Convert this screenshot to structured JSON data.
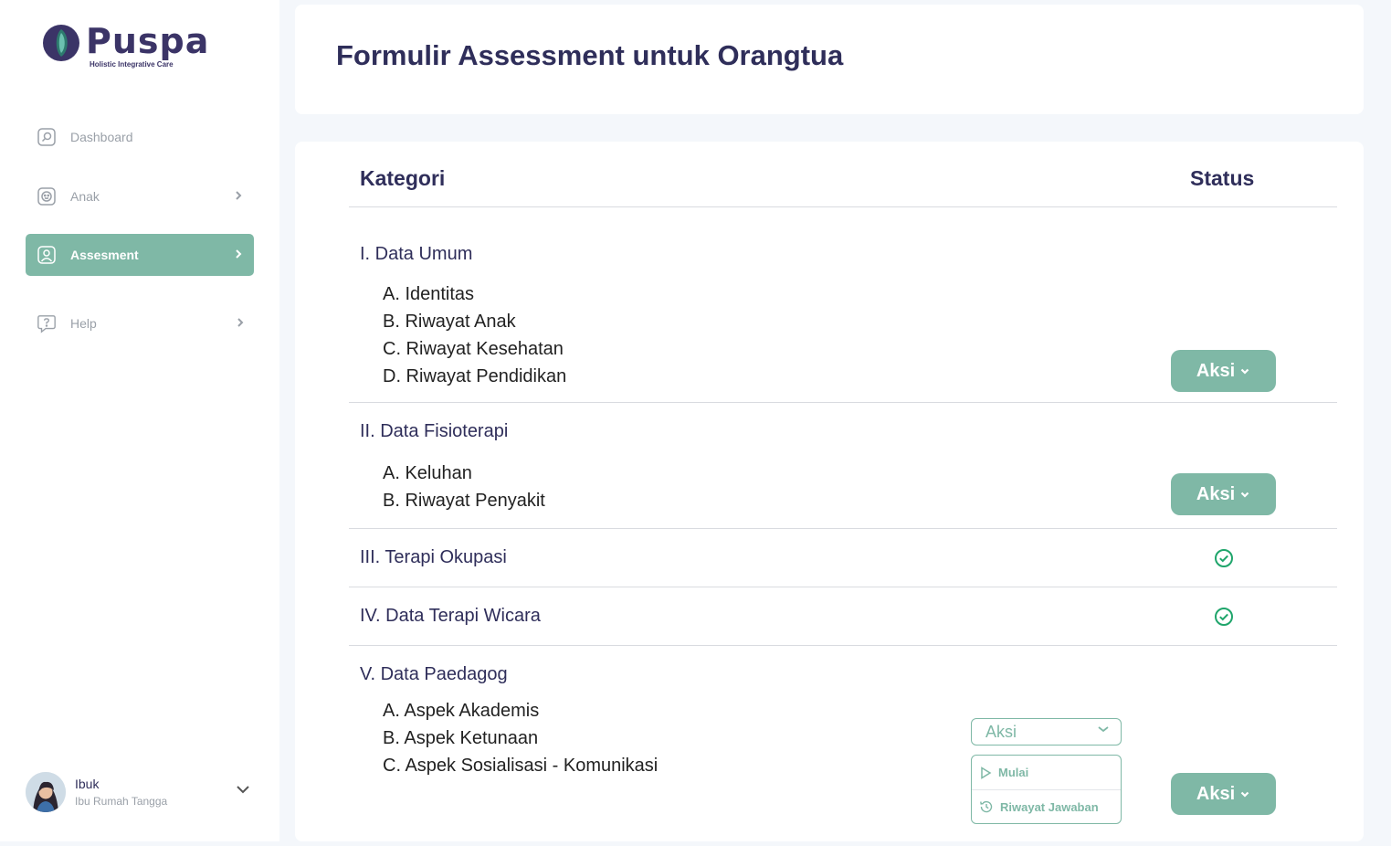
{
  "brand": {
    "name": "Puspa",
    "tagline": "Holistic Integrative Care",
    "mark_color": "#3b3467",
    "accent_color": "#2d7a6e"
  },
  "sidebar": {
    "items": [
      {
        "label": "Dashboard",
        "icon": "dashboard-icon",
        "has_chevron": false,
        "active": false
      },
      {
        "label": "Anak",
        "icon": "child-face-icon",
        "has_chevron": true,
        "active": false
      },
      {
        "label": "Assesment",
        "icon": "user-card-icon",
        "has_chevron": true,
        "active": true
      },
      {
        "label": "Help",
        "icon": "help-bubble-icon",
        "has_chevron": true,
        "active": false
      }
    ],
    "active_color": "#7fb8a6"
  },
  "profile": {
    "name": "Ibuk",
    "role": "Ibu Rumah Tangga"
  },
  "header": {
    "title": "Formulir Assessment untuk Orangtua"
  },
  "table": {
    "columns": {
      "category": "Kategori",
      "status": "Status"
    },
    "sections": [
      {
        "title": "I. Data Umum",
        "items": [
          "A. Identitas",
          "B. Riwayat Anak",
          "C. Riwayat Kesehatan",
          "D. Riwayat Pendidikan"
        ],
        "status": "button",
        "button_label": "Aksi"
      },
      {
        "title": "II. Data Fisioterapi",
        "items": [
          "A. Keluhan",
          "B. Riwayat Penyakit"
        ],
        "status": "button",
        "button_label": "Aksi"
      },
      {
        "title": "III. Terapi Okupasi",
        "items": [],
        "status": "complete",
        "icon": "check-circle-icon"
      },
      {
        "title": "IV. Data Terapi Wicara",
        "items": [],
        "status": "complete",
        "icon": "check-circle-icon"
      },
      {
        "title": "V. Data Paedagog",
        "items": [
          "A. Aspek Akademis",
          "B. Aspek Ketunaan",
          "C. Aspek Sosialisasi - Komunikasi"
        ],
        "status": "button",
        "button_label": "Aksi"
      }
    ]
  },
  "dropdown": {
    "label": "Aksi",
    "options": [
      {
        "label": "Mulai",
        "icon": "play-icon"
      },
      {
        "label": "Riwayat Jawaban",
        "icon": "history-icon"
      }
    ]
  },
  "colors": {
    "primary_text": "#2f2e5a",
    "accent": "#7fb8a6",
    "success": "#1fa56b"
  }
}
